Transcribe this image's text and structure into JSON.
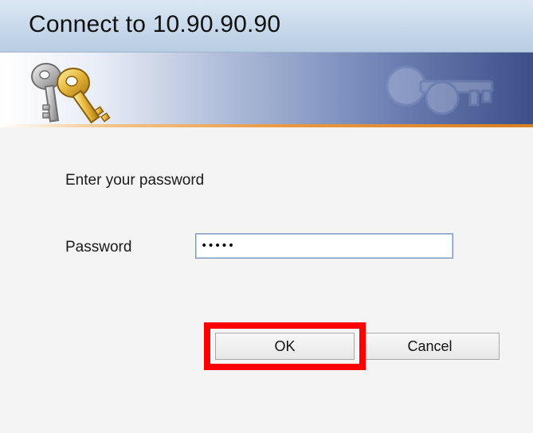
{
  "window": {
    "title": "Connect to 10.90.90.90"
  },
  "banner": {
    "icon": "keys-icon"
  },
  "form": {
    "prompt": "Enter your password",
    "password_label": "Password",
    "password_value": "•••••"
  },
  "buttons": {
    "ok_label": "OK",
    "cancel_label": "Cancel"
  },
  "annotation": {
    "highlight_target": "ok-button",
    "highlight_color": "#ff0000"
  }
}
